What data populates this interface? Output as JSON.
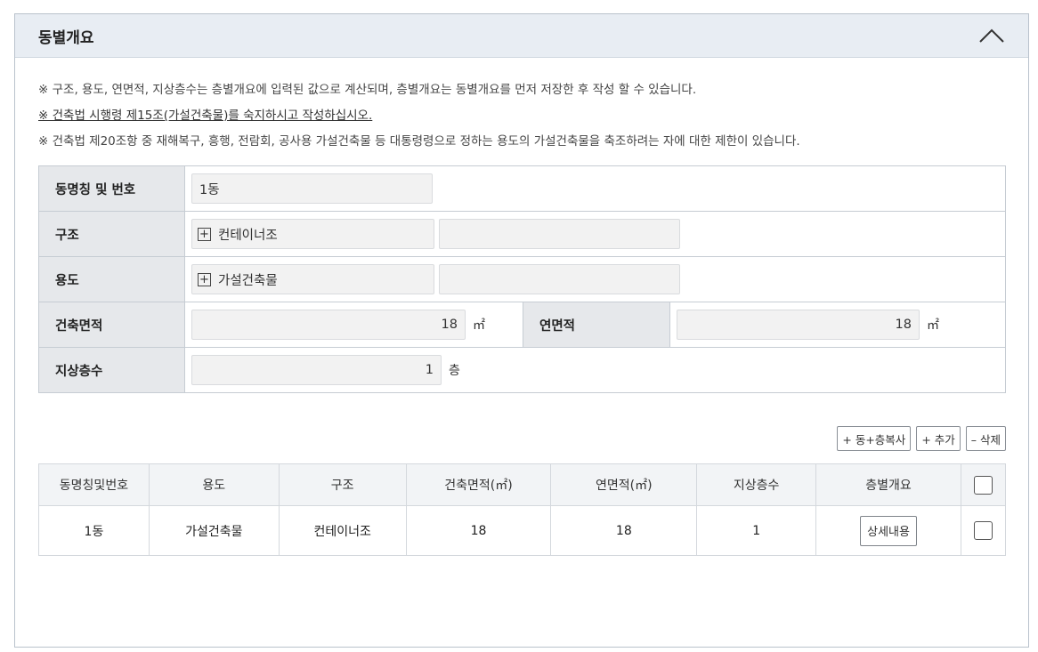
{
  "section": {
    "title": "동별개요",
    "collapse_icon": "chevron-up-icon"
  },
  "notices": [
    "※ 구조, 용도, 연면적, 지상층수는 층별개요에 입력된 값으로 계산되며, 층별개요는 동별개요를 먼저 저장한 후 작성 할 수 있습니다.",
    "※ 건축법 시행령 제15조(가설건축물)를 숙지하시고 작성하십시오.",
    "※ 건축법 제20조항 중 재해복구, 흥행, 전람회, 공사용 가설건축물 등 대통령령으로 정하는 용도의 가설건축물을 축조하려는 자에 대한 제한이 있습니다."
  ],
  "form": {
    "name": {
      "label": "동명칭 및 번호",
      "value": "1동"
    },
    "structure": {
      "label": "구조",
      "value": "컨테이너조",
      "value2": ""
    },
    "usage": {
      "label": "용도",
      "value": "가설건축물",
      "value2": ""
    },
    "building_area": {
      "label": "건축면적",
      "value": "18",
      "unit": "㎡"
    },
    "total_floor_area": {
      "label": "연면적",
      "value": "18",
      "unit": "㎡"
    },
    "floors_above": {
      "label": "지상층수",
      "value": "1",
      "unit": "층"
    },
    "plus_symbol": "+"
  },
  "actions": {
    "copy_label": "+ 동+층복사",
    "add_label": "+ 추가",
    "delete_label": "– 삭제"
  },
  "table": {
    "columns": [
      "동명칭및번호",
      "용도",
      "구조",
      "건축면적(㎡)",
      "연면적(㎡)",
      "지상층수",
      "층별개요"
    ],
    "rows": [
      {
        "name": "1동",
        "usage": "가설건축물",
        "structure": "컨테이너조",
        "building_area": "18",
        "total_area": "18",
        "floors": "1",
        "detail_label": "상세내용"
      }
    ]
  }
}
